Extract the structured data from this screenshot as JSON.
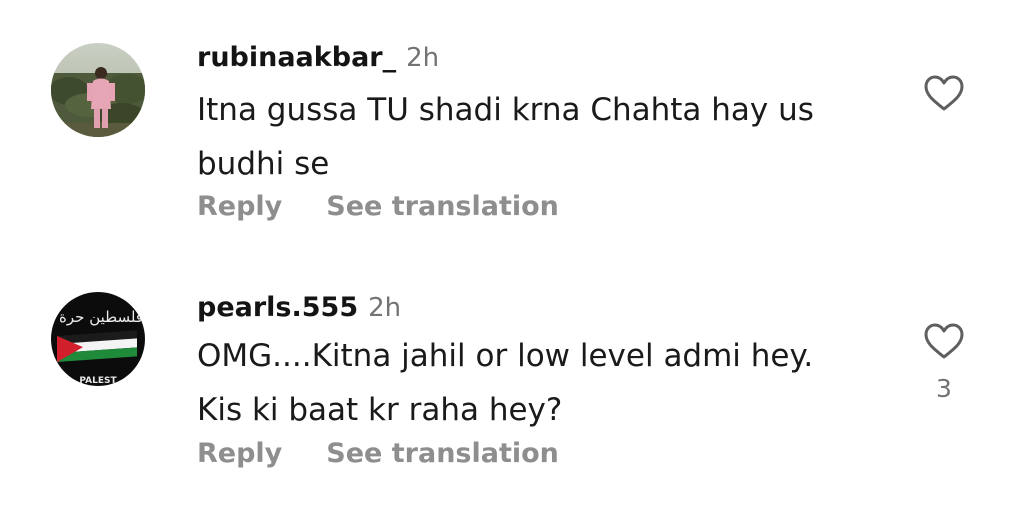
{
  "comments": [
    {
      "username": "rubinaakbar_",
      "time": "2h",
      "text": "Itna gussa TU shadi krna Chahta hay us budhi se",
      "reply_label": "Reply",
      "translate_label": "See translation",
      "like_count": "",
      "avatar_icon": "profile-photo"
    },
    {
      "username": "pearls.555",
      "time": "2h",
      "text": "OMG....Kitna jahil or low level admi hey. Kis ki baat kr raha hey?",
      "reply_label": "Reply",
      "translate_label": "See translation",
      "like_count": "3",
      "avatar_icon": "palestine-flag-photo"
    }
  ],
  "avatar2_text": {
    "script": "فلسطين حرة",
    "banner": "PALEST"
  },
  "colors": {
    "username": "#141414",
    "text": "#1a1a1a",
    "meta": "#8e8e8e",
    "time": "#737373",
    "heart": "#5f5f5f"
  },
  "icons": {
    "like": "heart-outline-icon"
  }
}
